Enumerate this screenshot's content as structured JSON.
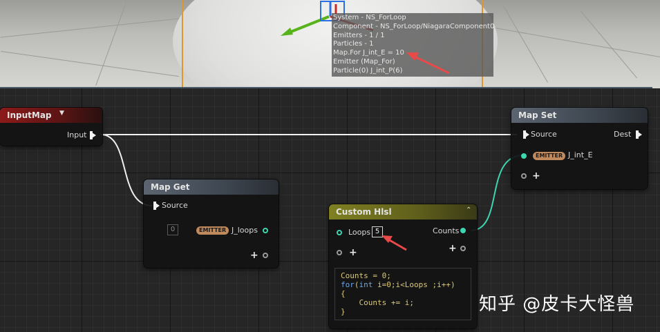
{
  "viewport": {
    "stats": [
      "System - NS_ForLoop",
      "Component - NS_ForLoop/NiagaraComponent0",
      "Emitters - 1 / 1",
      "Particles - 1",
      "Map.For J_int_E = 10",
      "Emitter (Map_For)",
      " Particle(0) J_int_P(6)"
    ]
  },
  "nodes": {
    "input_map": {
      "title": "InputMap",
      "dropdown_icon": "chevron-down-icon",
      "pins": {
        "input": "Input"
      }
    },
    "map_set": {
      "title": "Map Set",
      "pins": {
        "source": "Source",
        "dest": "Dest",
        "emitter_badge": "EMITTER",
        "var": "J_int_E"
      }
    },
    "map_get": {
      "title": "Map Get",
      "pins": {
        "source": "Source",
        "default_value": "0",
        "emitter_badge": "EMITTER",
        "var": "J_loops"
      }
    },
    "custom_hlsl": {
      "title": "Custom Hlsl",
      "collapse_icon": "chevron-up-icon",
      "pins": {
        "loops": "Loops",
        "loops_value": "5",
        "counts": "Counts"
      },
      "code": [
        {
          "indent": "",
          "parts": [
            {
              "t": "Counts = 0;",
              "kw": false
            }
          ]
        },
        {
          "indent": "",
          "parts": [
            {
              "t": "for",
              "kw": true
            },
            {
              "t": "(",
              "kw": false
            },
            {
              "t": "int",
              "kw": true
            },
            {
              "t": " i=0;i<Loops ;i++)",
              "kw": false
            }
          ]
        },
        {
          "indent": "",
          "parts": [
            {
              "t": "{",
              "kw": false
            }
          ]
        },
        {
          "indent": "    ",
          "parts": [
            {
              "t": "Counts += i;",
              "kw": false
            }
          ]
        },
        {
          "indent": "",
          "parts": [
            {
              "t": "}",
              "kw": false
            }
          ]
        }
      ]
    }
  },
  "watermark": "知乎 @皮卡大怪兽",
  "colors": {
    "annotation_arrow": "#e84a4a",
    "wire_exec": "#f0f0f0",
    "wire_data": "#3cd6b0",
    "gizmo_green": "#58b21a",
    "gizmo_red": "#c82828",
    "gizmo_blue": "#2b6fe0"
  }
}
